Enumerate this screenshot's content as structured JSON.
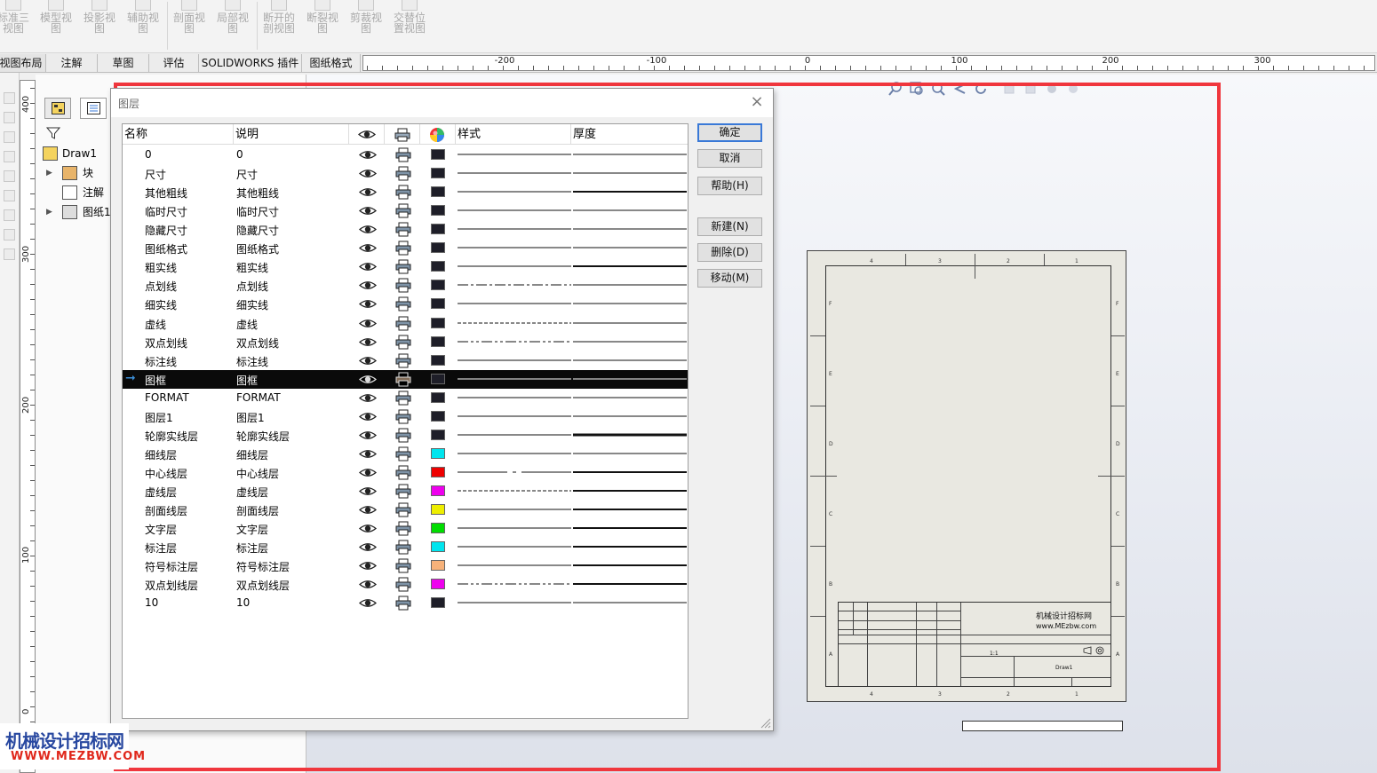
{
  "ribbon": {
    "buttons": [
      {
        "line1": "标准三",
        "line2": "视图"
      },
      {
        "line1": "模型视",
        "line2": "图"
      },
      {
        "line1": "投影视",
        "line2": "图"
      },
      {
        "line1": "辅助视",
        "line2": "图"
      },
      {
        "line1": "剖面视",
        "line2": "图"
      },
      {
        "line1": "局部视",
        "line2": "图"
      },
      {
        "line1": "断开的",
        "line2": "剖视图"
      },
      {
        "line1": "断裂视",
        "line2": "图"
      },
      {
        "line1": "剪裁视",
        "line2": "图"
      },
      {
        "line1": "交替位",
        "line2": "置视图"
      }
    ]
  },
  "tabs": [
    "视图布局",
    "注解",
    "草图",
    "评估",
    "SOLIDWORKS 插件",
    "图纸格式"
  ],
  "hruler": {
    "labels": [
      "-200",
      "-100",
      "0",
      "100",
      "200",
      "300"
    ]
  },
  "vruler": {
    "labels": [
      "400",
      "300",
      "200",
      "100",
      "0"
    ]
  },
  "feature_tree": {
    "root": "Draw1",
    "items": [
      "块",
      "注解",
      "图纸1"
    ]
  },
  "dialog": {
    "title": "图层",
    "close": "×",
    "columns": {
      "name": "名称",
      "desc": "说明",
      "style": "样式",
      "thickness": "厚度"
    },
    "buttons": {
      "ok": "确定",
      "cancel": "取消",
      "help": "帮助(H)",
      "new": "新建(N)",
      "delete": "删除(D)",
      "move": "移动(M)"
    },
    "layers": [
      {
        "name": "0",
        "desc": "0",
        "color": "#1e1e28",
        "style": "solid",
        "thick": 1
      },
      {
        "name": "尺寸",
        "desc": "尺寸",
        "color": "#1e1e28",
        "style": "solid",
        "thick": 1
      },
      {
        "name": "其他粗线",
        "desc": "其他粗线",
        "color": "#1e1e28",
        "style": "solid",
        "thick": 2
      },
      {
        "name": "临时尺寸",
        "desc": "临时尺寸",
        "color": "#1e1e28",
        "style": "solid",
        "thick": 1
      },
      {
        "name": "隐藏尺寸",
        "desc": "隐藏尺寸",
        "color": "#1e1e28",
        "style": "solid",
        "thick": 1
      },
      {
        "name": "图纸格式",
        "desc": "图纸格式",
        "color": "#1e1e28",
        "style": "solid",
        "thick": 1
      },
      {
        "name": "粗实线",
        "desc": "粗实线",
        "color": "#1e1e28",
        "style": "solid",
        "thick": 2
      },
      {
        "name": "点划线",
        "desc": "点划线",
        "color": "#1e1e28",
        "style": "dashdot",
        "thick": 1
      },
      {
        "name": "细实线",
        "desc": "细实线",
        "color": "#1e1e28",
        "style": "solid",
        "thick": 1
      },
      {
        "name": "虚线",
        "desc": "虚线",
        "color": "#1e1e28",
        "style": "dashed",
        "thick": 1
      },
      {
        "name": "双点划线",
        "desc": "双点划线",
        "color": "#1e1e28",
        "style": "dashdotdot",
        "thick": 1
      },
      {
        "name": "标注线",
        "desc": "标注线",
        "color": "#1e1e28",
        "style": "solid",
        "thick": 1
      },
      {
        "name": "图框",
        "desc": "图框",
        "color": "#1e1e28",
        "style": "solid",
        "thick": 1,
        "selected": true
      },
      {
        "name": "FORMAT",
        "desc": "FORMAT",
        "color": "#1e1e28",
        "style": "solid",
        "thick": 1
      },
      {
        "name": "图层1",
        "desc": "图层1",
        "color": "#1e1e28",
        "style": "solid",
        "thick": 1
      },
      {
        "name": "轮廓实线层",
        "desc": "轮廓实线层",
        "color": "#1e1e28",
        "style": "solid",
        "thick": 3
      },
      {
        "name": "细线层",
        "desc": "细线层",
        "color": "#00e5ee",
        "style": "solid",
        "thick": 1
      },
      {
        "name": "中心线层",
        "desc": "中心线层",
        "color": "#ee0000",
        "style": "center",
        "thick": 2
      },
      {
        "name": "虚线层",
        "desc": "虚线层",
        "color": "#ee00ee",
        "style": "dashed",
        "thick": 2
      },
      {
        "name": "剖面线层",
        "desc": "剖面线层",
        "color": "#eeee00",
        "style": "solid",
        "thick": 2
      },
      {
        "name": "文字层",
        "desc": "文字层",
        "color": "#00dd00",
        "style": "solid",
        "thick": 2
      },
      {
        "name": "标注层",
        "desc": "标注层",
        "color": "#00e5ee",
        "style": "solid",
        "thick": 2
      },
      {
        "name": "符号标注层",
        "desc": "符号标注层",
        "color": "#f7b27a",
        "style": "solid",
        "thick": 2
      },
      {
        "name": "双点划线层",
        "desc": "双点划线层",
        "color": "#ee00ee",
        "style": "dashdotdot",
        "thick": 2
      },
      {
        "name": "10",
        "desc": "10",
        "color": "#1e1e28",
        "style": "solid",
        "thick": 1
      }
    ]
  },
  "sheet": {
    "zone_numbers": [
      "4",
      "3",
      "2",
      "1"
    ],
    "zone_letters": [
      "F",
      "E",
      "D",
      "C",
      "B",
      "A"
    ],
    "company_name": "机械设计招标网",
    "company_url": "www.MEzbw.com",
    "drawing_name": "Draw1",
    "scale": "1:1"
  },
  "watermark": {
    "line1": "机械设计招标网",
    "line2": "WWW.MEZBW.COM"
  },
  "colors": {
    "highlight": "#f0363d",
    "accent": "#3a79d7"
  }
}
